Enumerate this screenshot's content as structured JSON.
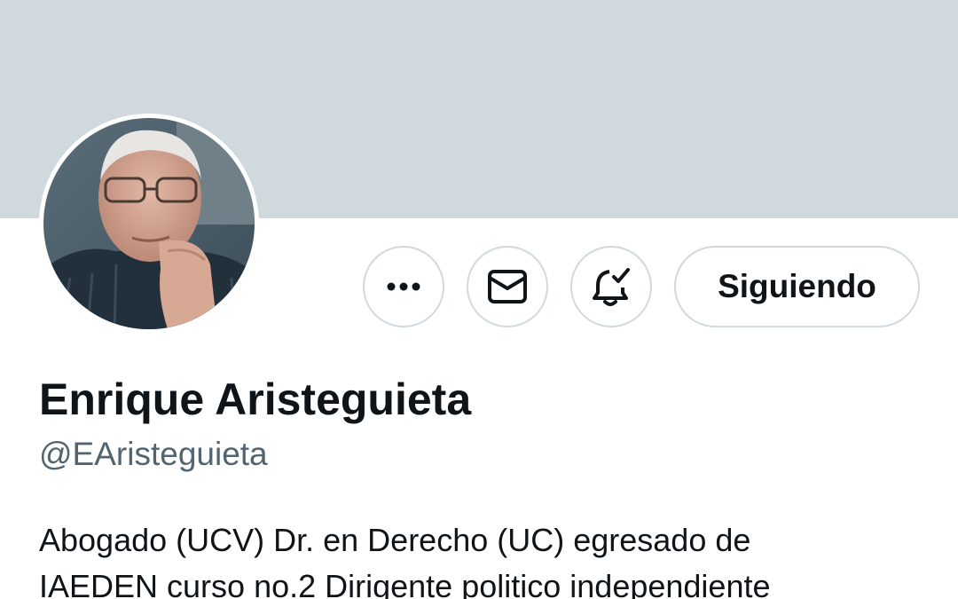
{
  "profile": {
    "display_name": "Enrique Aristeguieta",
    "handle": "@EAristeguieta",
    "bio_lines": [
      "Abogado (UCV) Dr. en Derecho (UC) egresado de",
      "IAEDEN curso no.2 Dirigente politico independiente"
    ]
  },
  "actions": {
    "more_icon": "more-horizontal-icon",
    "message_icon": "envelope-icon",
    "notifications_icon": "bell-check-icon",
    "follow_label": "Siguiendo"
  },
  "colors": {
    "banner": "#cfd9de",
    "button_border": "#cfd9de",
    "text_primary": "#0f1419",
    "text_secondary": "#536471"
  }
}
